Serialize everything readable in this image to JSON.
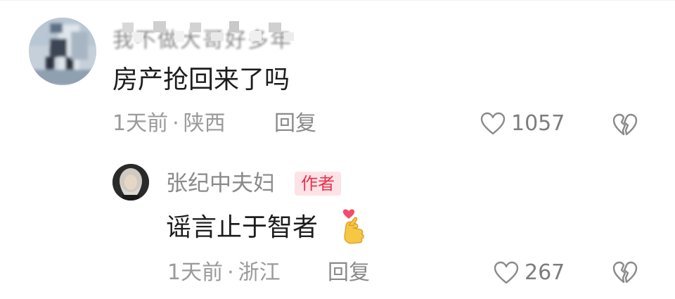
{
  "comment": {
    "username_obscured": "我不做大哥好多年",
    "text": "房产抢回来了吗",
    "time": "1天前",
    "separator": "·",
    "location": "陕西",
    "reply_label": "回复",
    "like_count": "1057",
    "avatar_icon": "user-avatar-photo",
    "like_icon": "heart-outline-icon",
    "dislike_icon": "broken-heart-icon"
  },
  "reply": {
    "author": "张纪中夫妇",
    "author_badge": "作者",
    "text": "谣言止于智者",
    "emoji": "finger-heart-emoji",
    "time": "1天前",
    "separator": "·",
    "location": "浙江",
    "reply_label": "回复",
    "like_count": "267",
    "avatar_icon": "author-avatar-photo",
    "like_icon": "heart-outline-icon",
    "dislike_icon": "broken-heart-icon"
  },
  "colors": {
    "primary_text": "#1d1d1d",
    "secondary_text": "#9a9a9a",
    "badge_text": "#e8334a",
    "badge_bg": "#fde2e6"
  }
}
